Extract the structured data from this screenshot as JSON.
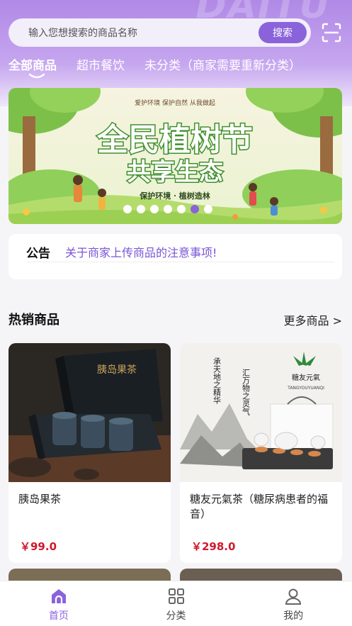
{
  "header": {
    "watermark": "DAITU",
    "search": {
      "placeholder": "输入您想搜索的商品名称",
      "button_label": "搜索"
    },
    "tabs": [
      {
        "label": "全部商品",
        "active": true
      },
      {
        "label": "超市餐饮",
        "active": false
      },
      {
        "label": "未分类（商家需要重新分类）",
        "active": false
      }
    ]
  },
  "banner": {
    "small_header": "爱护环境 保护自然 从我做起",
    "headline_1": "全民植树节",
    "headline_2": "共享生态",
    "slogan": "保护环境 · 植树造林",
    "dot_count": 7,
    "active_dot": 5
  },
  "notice": {
    "label": "公告",
    "text": "关于商家上传商品的注意事项!"
  },
  "hot_products": {
    "title": "热销商品",
    "more_label": "更多商品 >",
    "items": [
      {
        "name": "胰岛果茶",
        "price": "￥99.0",
        "image_text": "胰岛果茶"
      },
      {
        "name": "糖友元氣茶（糖尿病患者的福音）",
        "price": "￥298.0",
        "image_brand": "糖友元氣",
        "image_brand_en": "TANGYOUYUANQI",
        "image_poem_1": "承天地之精华",
        "image_poem_2": "汇万物之灵气"
      }
    ]
  },
  "bottom_nav": {
    "items": [
      {
        "label": "首页",
        "icon": "home-icon",
        "active": true
      },
      {
        "label": "分类",
        "icon": "grid-icon",
        "active": false
      },
      {
        "label": "我的",
        "icon": "user-icon",
        "active": false
      }
    ]
  },
  "colors": {
    "accent": "#8a63db",
    "price": "#d0182c",
    "header_top": "#b089e6"
  }
}
